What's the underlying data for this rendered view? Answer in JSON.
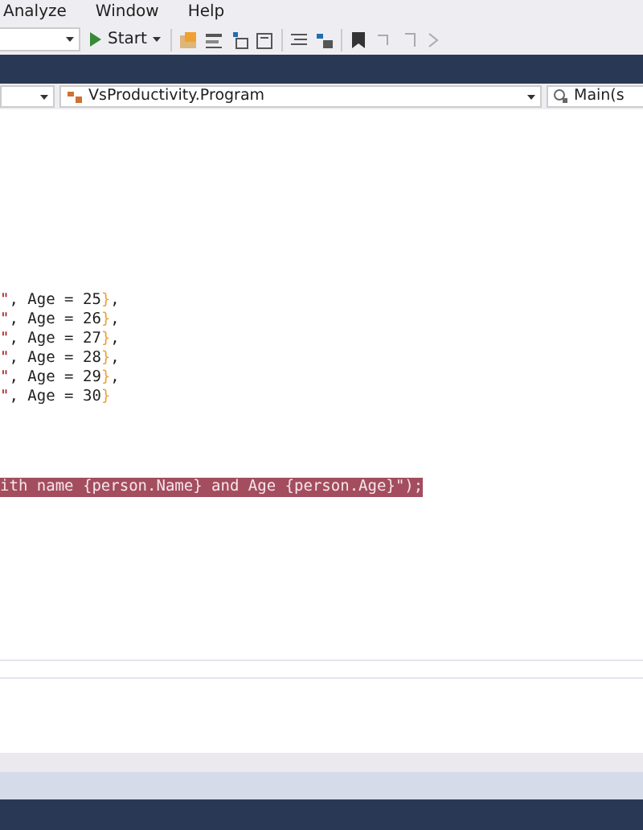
{
  "menu": [
    {
      "label": "Analyze"
    },
    {
      "label": "Window"
    },
    {
      "label": "Help"
    }
  ],
  "toolbar": {
    "start_button": {
      "label": "Start"
    }
  },
  "navigation_bar": {
    "class_dropdown": {
      "value": "VsProductivity.Program"
    },
    "member_dropdown": {
      "value": "Main(s"
    }
  },
  "code_lines": [
    {
      "selected": false,
      "segments": [
        {
          "kind": "string",
          "text": "\""
        },
        {
          "kind": "plain",
          "text": ", Age = 25"
        },
        {
          "kind": "brace",
          "text": "}"
        },
        {
          "kind": "plain",
          "text": ","
        }
      ]
    },
    {
      "selected": false,
      "segments": [
        {
          "kind": "string",
          "text": "\""
        },
        {
          "kind": "plain",
          "text": ", Age = 26"
        },
        {
          "kind": "brace",
          "text": "}"
        },
        {
          "kind": "plain",
          "text": ","
        }
      ]
    },
    {
      "selected": false,
      "segments": [
        {
          "kind": "string",
          "text": "\""
        },
        {
          "kind": "plain",
          "text": ", Age = 27"
        },
        {
          "kind": "brace",
          "text": "}"
        },
        {
          "kind": "plain",
          "text": ","
        }
      ]
    },
    {
      "selected": false,
      "segments": [
        {
          "kind": "string",
          "text": "\""
        },
        {
          "kind": "plain",
          "text": ", Age = 28"
        },
        {
          "kind": "brace",
          "text": "}"
        },
        {
          "kind": "plain",
          "text": ","
        }
      ]
    },
    {
      "selected": false,
      "segments": [
        {
          "kind": "string",
          "text": "\""
        },
        {
          "kind": "plain",
          "text": ", Age = 29"
        },
        {
          "kind": "brace",
          "text": "}"
        },
        {
          "kind": "plain",
          "text": ","
        }
      ]
    },
    {
      "selected": false,
      "segments": [
        {
          "kind": "string",
          "text": "\""
        },
        {
          "kind": "plain",
          "text": ", Age = 30"
        },
        {
          "kind": "brace",
          "text": "}"
        }
      ]
    },
    {
      "selected": true,
      "segments": [
        {
          "kind": "plain",
          "text": "ith name {person.Name} and Age {person.Age}\");"
        }
      ]
    }
  ]
}
